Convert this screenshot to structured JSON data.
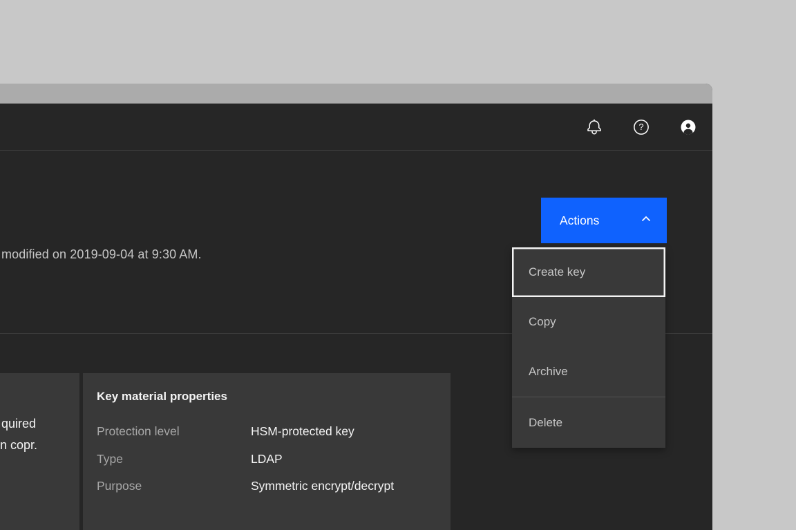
{
  "colors": {
    "outer_background": "#c8c8c8",
    "window_topbar": "#ababab",
    "app_background": "#262626",
    "tile_background": "#393939",
    "divider": "#3d3d3d",
    "accent_blue": "#0f62fe",
    "text_primary": "#f4f4f4",
    "text_secondary": "#c6c6c6",
    "text_label": "#a8a8a8"
  },
  "header": {
    "icons": [
      {
        "name": "notification-bell-icon"
      },
      {
        "name": "help-icon"
      },
      {
        "name": "user-avatar-icon"
      }
    ]
  },
  "page_header": {
    "modified_text": "modified on 2019-09-04 at 9:30 AM.",
    "actions_button_label": "Actions",
    "actions_chevron": "chevron-up-icon"
  },
  "dropdown": {
    "items": [
      {
        "label": "Create key",
        "focused": true
      },
      {
        "label": "Copy",
        "focused": false
      },
      {
        "label": "Archive",
        "focused": false
      },
      {
        "label": "Delete",
        "focused": false,
        "divider_above": true
      }
    ]
  },
  "left_card": {
    "truncated_line_1": "quired",
    "truncated_line_2": "n copr."
  },
  "properties_card": {
    "title": "Key material properties",
    "rows": [
      {
        "label": "Protection level",
        "value": "HSM-protected key"
      },
      {
        "label": "Type",
        "value": "LDAP"
      },
      {
        "label": "Purpose",
        "value": "Symmetric encrypt/decrypt"
      }
    ]
  }
}
